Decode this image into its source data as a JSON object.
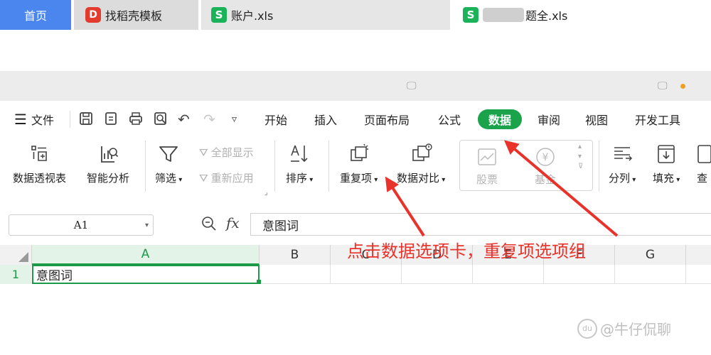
{
  "tabs": {
    "home": "首页",
    "template": "找稻壳模板",
    "file1": "账户.xls",
    "file2": "题全.xls"
  },
  "menu": {
    "file": "文件",
    "items": [
      "开始",
      "插入",
      "页面布局",
      "公式",
      "数据",
      "审阅",
      "视图",
      "开发工具"
    ]
  },
  "ribbon": {
    "pivot": "数据透视表",
    "smart": "智能分析",
    "filter": "筛选",
    "show_all": "全部显示",
    "reapply": "重新应用",
    "sort": "排序",
    "duplicates": "重复项",
    "compare": "数据对比",
    "stock": "股票",
    "fund": "基金",
    "split": "分列",
    "fill": "填充",
    "lookup": "查"
  },
  "formula": {
    "name_box": "A1",
    "fx": "fx",
    "content": "意图词"
  },
  "grid": {
    "columns": [
      "A",
      "B",
      "C",
      "D",
      "E",
      "F",
      "G"
    ],
    "row1": "1",
    "a1": "意图词"
  },
  "annotation": "点击数据选项卡，重复项选项组",
  "watermark": "@牛仔侃聊",
  "watermark_logo": "du"
}
